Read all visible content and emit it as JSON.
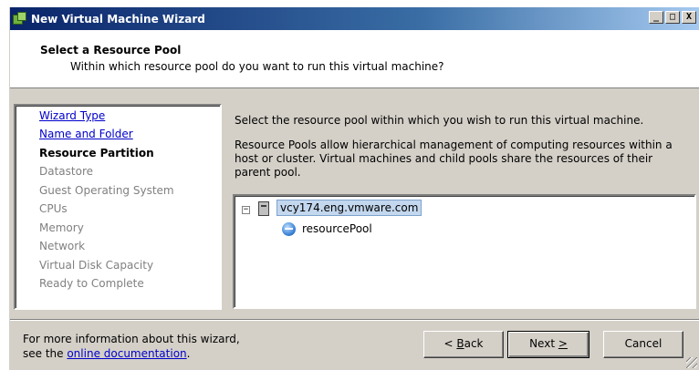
{
  "window": {
    "title": "New Virtual Machine Wizard",
    "controls": {
      "minimize": "_",
      "maximize": "□",
      "close": "X"
    }
  },
  "header": {
    "title": "Select a Resource Pool",
    "subtitle": "Within which resource pool do you want to run this virtual machine?"
  },
  "nav": {
    "items": [
      {
        "label": "Wizard Type",
        "state": "link"
      },
      {
        "label": "Name and Folder",
        "state": "link"
      },
      {
        "label": "Resource Partition",
        "state": "current"
      },
      {
        "label": "Datastore",
        "state": "disabled"
      },
      {
        "label": "Guest Operating System",
        "state": "disabled"
      },
      {
        "label": "CPUs",
        "state": "disabled"
      },
      {
        "label": "Memory",
        "state": "disabled"
      },
      {
        "label": "Network",
        "state": "disabled"
      },
      {
        "label": "Virtual Disk Capacity",
        "state": "disabled"
      },
      {
        "label": "Ready to Complete",
        "state": "disabled"
      }
    ]
  },
  "main": {
    "instruction": "Select the resource pool within which you wish to run this virtual machine.",
    "description": "Resource Pools allow hierarchical management of computing resources within a host or cluster. Virtual machines and child pools share the resources of their parent pool.",
    "tree": {
      "expander": "−",
      "host": {
        "label": "vcy174.eng.vmware.com",
        "icon": "server-icon",
        "selected": true
      },
      "pool": {
        "label": "resourcePool",
        "icon": "resource-pool-icon"
      }
    }
  },
  "footer": {
    "info_line1": "For more information about this wizard,",
    "info_prefix": "see the ",
    "info_link": "online documentation",
    "info_suffix": ".",
    "back_label_mnemonic": "B",
    "back_label_rest": "ack",
    "back_prefix": "< ",
    "next_label": "Next ",
    "next_mnemonic": ">",
    "cancel_label": "Cancel"
  },
  "colors": {
    "titlebar_start": "#0a246a",
    "titlebar_end": "#a6caf0",
    "link": "#0000cc",
    "selection": "#c3d7ee",
    "face": "#d4d0c8"
  }
}
